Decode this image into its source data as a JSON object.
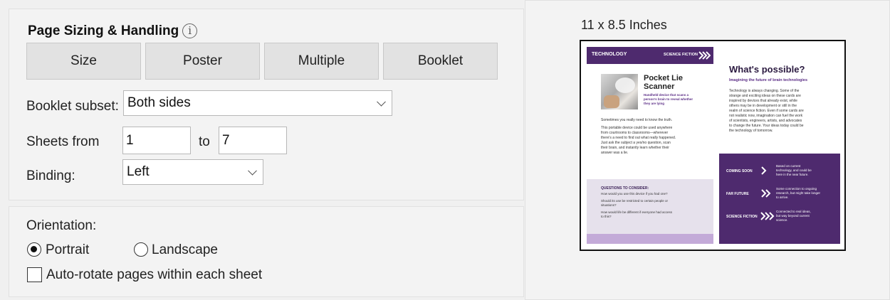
{
  "sizing": {
    "title": "Page Sizing & Handling",
    "info_icon": "info-icon",
    "tabs": [
      "Size",
      "Poster",
      "Multiple",
      "Booklet"
    ],
    "booklet_subset_label": "Booklet subset:",
    "booklet_subset_value": "Both sides",
    "sheets_from_label": "Sheets from",
    "sheets_from_value": "1",
    "sheets_to_label": "to",
    "sheets_to_value": "7",
    "binding_label": "Binding:",
    "binding_value": "Left"
  },
  "orientation": {
    "label": "Orientation:",
    "portrait_label": "Portrait",
    "landscape_label": "Landscape",
    "selected": "Portrait",
    "auto_rotate_label": "Auto-rotate pages within each sheet",
    "auto_rotate_checked": false
  },
  "preview": {
    "size_label": "11 x 8.5 Inches",
    "left_page": {
      "header_left": "TECHNOLOGY",
      "header_right": "SCIENCE FICTION",
      "card_title_1": "Pocket Lie",
      "card_title_2": "Scanner",
      "card_sub_1": "Handheld device that scans a",
      "card_sub_2": "person's brain to reveal whether",
      "card_sub_3": "they are lying",
      "body_1": "Sometimes you really need to know the truth.",
      "body_2": "This portable device could be used anywhere",
      "body_3": "from courtrooms to classrooms—wherever",
      "body_4": "there's a need to find out what really happened.",
      "body_5": "Just ask the subject a yes/no question, scan",
      "body_6": "their brain, and instantly learn whether their",
      "body_7": "answer was a lie.",
      "q_title": "QUESTIONS TO CONSIDER:",
      "q_1": "How would you use this device if you had one?",
      "q_2": "Should its use be restricted to certain people or",
      "q_3": "situations?",
      "q_4": "How would life be different if everyone had access",
      "q_5": "to this?"
    },
    "right_page": {
      "heading": "What's possible?",
      "subheading": "Imagining the future of brain technologies",
      "body_1": "Technology is always changing. Some of the",
      "body_2": "strange and exciting ideas on these cards are",
      "body_3": "inspired by devices that already exist, while",
      "body_4": "others may be in development or still in the",
      "body_5": "realm of science fiction. Even if some cards are",
      "body_6": "not realistic now, imagination can fuel the work",
      "body_7": "of scientists, engineers, artists, and advocates",
      "body_8": "to change the future. Your ideas today could be",
      "body_9": "the technology of tomorrow.",
      "row1_label": "COMING SOON",
      "row1_desc_1": "Based on current",
      "row1_desc_2": "technology, and could be",
      "row1_desc_3": "here in the near future.",
      "row2_label": "FAR FUTURE",
      "row2_desc_1": "Some connection to ongoing",
      "row2_desc_2": "research, but might take longer",
      "row2_desc_3": "to arrive.",
      "row3_label": "SCIENCE FICTION",
      "row3_desc_1": "Connected to real ideas,",
      "row3_desc_2": "but way beyond current",
      "row3_desc_3": "science."
    },
    "colors": {
      "purple": "#4e2a6e",
      "lavender": "#e6e1ec",
      "light_purple": "#c3aad8"
    }
  }
}
